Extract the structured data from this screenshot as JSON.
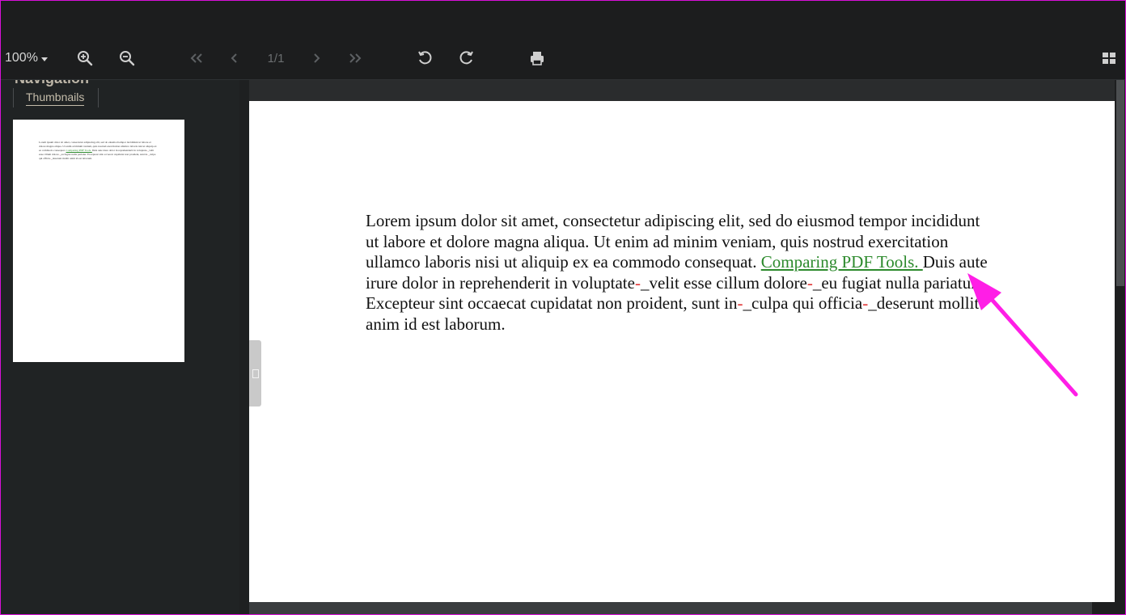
{
  "toolbar": {
    "zoom_value": "100%",
    "page_indicator": "1/1",
    "icons": [
      "zoom-in-icon",
      "zoom-out-icon",
      "first-page-icon",
      "previous-page-icon",
      "next-page-icon",
      "last-page-icon",
      "rotate-left-icon",
      "rotate-right-icon",
      "print-icon",
      "view-mode-icon"
    ]
  },
  "sidebar": {
    "title": "Navigation",
    "tabs": [
      {
        "label": "Thumbnails",
        "active": true
      }
    ]
  },
  "document": {
    "segments": [
      {
        "text": "Lorem ipsum dolor sit amet, consectetur adipiscing elit, sed do eiusmod tempor incididunt ut labore et dolore magna aliqua. Ut enim ad minim veniam, quis nostrud exercitation ullamco laboris nisi ut aliquip ex ea commodo consequat. "
      },
      {
        "text": "Comparing PDF Tools. ",
        "link": true
      },
      {
        "text": "Duis aute irure dolor in reprehenderit in voluptate"
      },
      {
        "text": "-",
        "mark": true
      },
      {
        "text": "_velit esse cillum dolore"
      },
      {
        "text": "-",
        "mark": true
      },
      {
        "text": "_eu fugiat nulla pariatur. Excepteur sint occaecat cupidatat non proident, sunt in"
      },
      {
        "text": "-",
        "mark": true
      },
      {
        "text": "_culpa qui officia"
      },
      {
        "text": "-",
        "mark": true
      },
      {
        "text": "_deserunt mollit anim id est laborum."
      }
    ]
  },
  "colors": {
    "link": "#2c8a2c",
    "annotation_arrow": "#ff1ee6",
    "hyphen_mark": "#e03030"
  }
}
